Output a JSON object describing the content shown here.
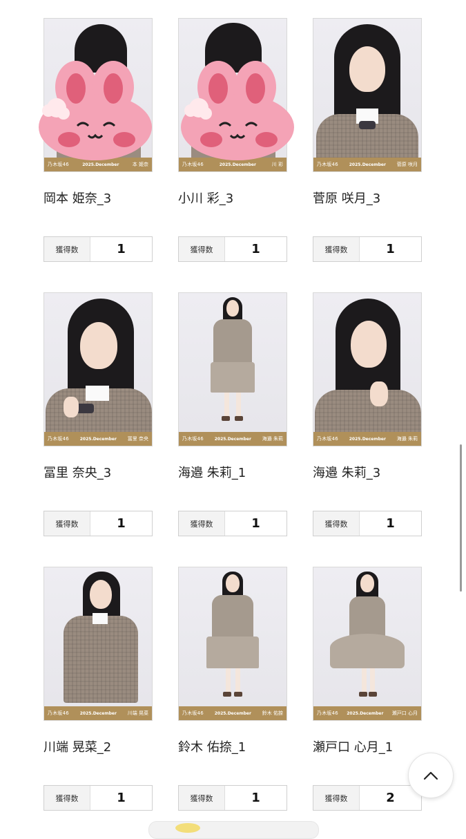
{
  "cards": [
    {
      "name": "岡本 姫奈_3",
      "count": "1",
      "band_member": "本 姫奈",
      "sticker": true
    },
    {
      "name": "小川 彩_3",
      "count": "1",
      "band_member": "川 彩",
      "sticker": true
    },
    {
      "name": "菅原 咲月_3",
      "count": "1",
      "band_member": "菅原 咲月",
      "sticker": false
    },
    {
      "name": "冨里 奈央_3",
      "count": "1",
      "band_member": "冨里 奈央",
      "sticker": false
    },
    {
      "name": "海邉 朱莉_1",
      "count": "1",
      "band_member": "海邉 朱莉",
      "sticker": false
    },
    {
      "name": "海邉 朱莉_3",
      "count": "1",
      "band_member": "海邉 朱莉",
      "sticker": false
    },
    {
      "name": "川端 晃菜_2",
      "count": "1",
      "band_member": "川端 晃菜",
      "sticker": false
    },
    {
      "name": "鈴木 佑捺_1",
      "count": "1",
      "band_member": "鈴木 佑捺",
      "sticker": false
    },
    {
      "name": "瀬戸口 心月_1",
      "count": "2",
      "band_member": "瀬戸口 心月",
      "sticker": false
    }
  ],
  "band": {
    "logo": "乃木坂46",
    "month": "2025.December"
  },
  "count_label": "獲得数",
  "colors": {
    "band": "#b0905a",
    "sticker": "#f4a3b6"
  },
  "icons": {
    "scroll_top": "chevron-up-icon"
  }
}
